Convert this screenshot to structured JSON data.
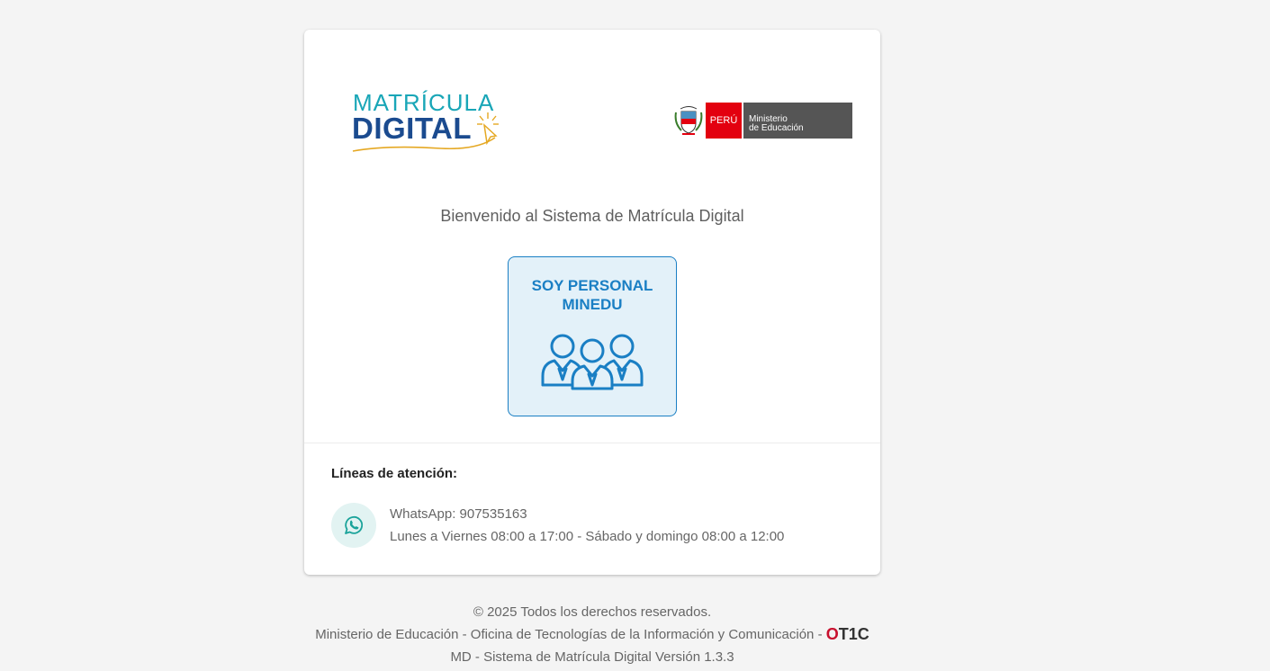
{
  "logos": {
    "matricula_line1": "MATRÍCULA",
    "matricula_line2": "DIGITAL",
    "gov_peru": "PERÚ",
    "gov_ministerio": "Ministerio",
    "gov_educacion": "de Educación"
  },
  "welcome_text": "Bienvenido al Sistema de Matrícula Digital",
  "persona_button": {
    "label": "SOY PERSONAL\nMINEDU",
    "icon": "users-group-icon"
  },
  "support": {
    "title": "Líneas de atención:",
    "icon": "whatsapp-icon",
    "whatsapp": "WhatsApp: 907535163",
    "hours": "Lunes a Viernes 08:00 a 17:00 - Sábado y domingo 08:00 a 12:00"
  },
  "footer": {
    "copyright": "© 2025 Todos los derechos reservados.",
    "ministry": "Ministerio de Educación - Oficina de Tecnologías de la Información y Comunicación - ",
    "otic_o": "O",
    "otic_rest": "T1C",
    "version": "MD - Sistema de Matrícula Digital Versión 1.3.3"
  },
  "colors": {
    "background": "#f4f4f4",
    "card": "#ffffff",
    "primary_blue": "#1a7fc4",
    "button_bg": "#e3f1f9",
    "peru_red": "#e3000f",
    "ministry_gray": "#555555",
    "logo_teal": "#19a6b7",
    "logo_navy": "#1b4b8f",
    "whatsapp_teal": "#1aa39a"
  }
}
